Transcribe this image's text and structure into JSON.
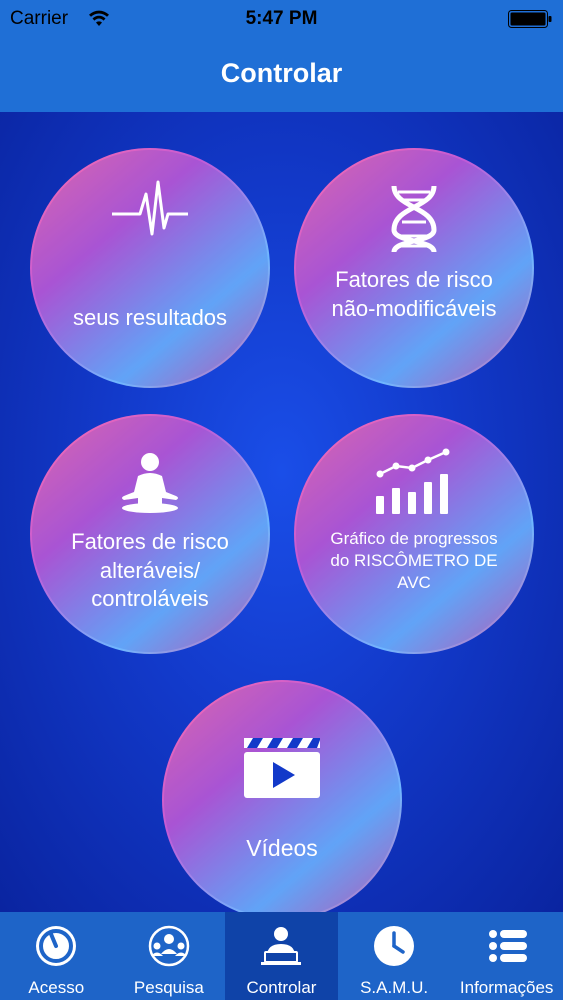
{
  "status_bar": {
    "carrier": "Carrier",
    "time": "5:47 PM"
  },
  "nav": {
    "title": "Controlar"
  },
  "tiles": {
    "results": {
      "label": "seus resultados",
      "icon": "heartbeat-icon"
    },
    "non_modifiable": {
      "label": "Fatores de risco não-modificáveis",
      "icon": "dna-icon"
    },
    "modifiable": {
      "label": "Fatores de risco alteráveis/ controláveis",
      "icon": "meditation-icon"
    },
    "progress_chart": {
      "label": "Gráfico de progressos do RISCÔMETRO DE AVC",
      "icon": "bar-chart-icon"
    },
    "videos": {
      "label": "Vídeos",
      "icon": "video-clapper-icon"
    }
  },
  "tab_bar": {
    "active": "Controlar",
    "items": [
      {
        "label": "Acesso",
        "icon": "dial-icon"
      },
      {
        "label": "Pesquisa",
        "icon": "group-icon"
      },
      {
        "label": "Controlar",
        "icon": "person-laptop-icon"
      },
      {
        "label": "S.A.M.U.",
        "icon": "clock-icon"
      },
      {
        "label": "Informações",
        "icon": "list-icon"
      }
    ]
  },
  "colors": {
    "nav_blue": "#1f6fd6",
    "background_blue": "#1239c9",
    "tab_bar_blue": "#1e64c8",
    "tab_active": "#0f43a8",
    "ring_pink": "#ff6fa9",
    "ring_blue": "#6fb7ff"
  }
}
